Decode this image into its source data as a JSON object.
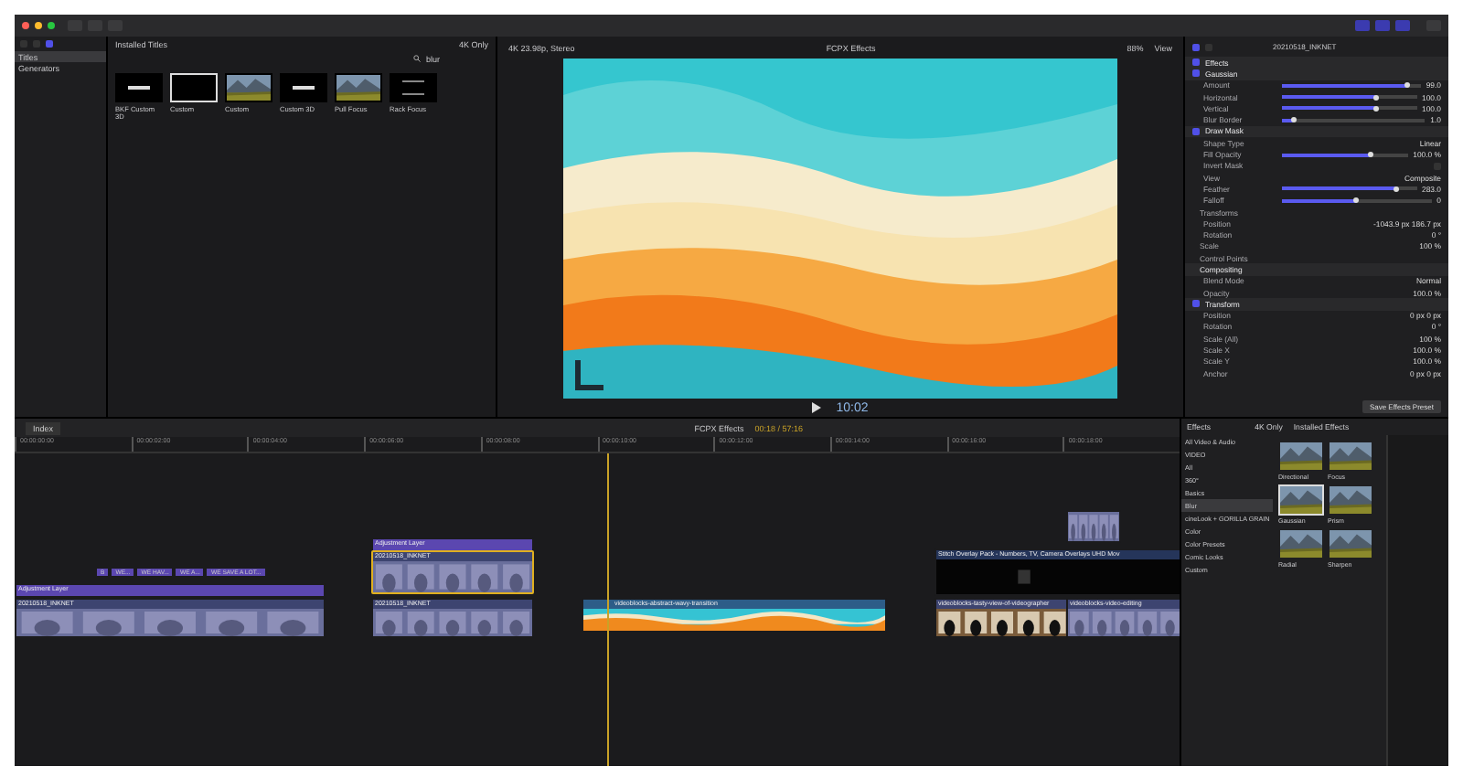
{
  "browser": {
    "sidebar": [
      {
        "label": "Titles",
        "selected": true
      },
      {
        "label": "Generators",
        "selected": false
      }
    ],
    "source": "Installed Titles",
    "filter": "4K Only",
    "search": "blur",
    "items": [
      {
        "label": "BKF Custom 3D",
        "kind": "text",
        "selected": false
      },
      {
        "label": "Custom",
        "kind": "dark",
        "selected": true
      },
      {
        "label": "Custom",
        "kind": "picture",
        "selected": false
      },
      {
        "label": "Custom 3D",
        "kind": "text",
        "selected": false
      },
      {
        "label": "Pull Focus",
        "kind": "picture",
        "selected": false
      },
      {
        "label": "Rack Focus",
        "kind": "lines",
        "selected": false
      }
    ]
  },
  "viewer": {
    "format": "4K 23.98p, Stereo",
    "title": "FCPX Effects",
    "zoom": "88%",
    "view": "View",
    "timecode": "10:02"
  },
  "inspector": {
    "clip": "20210518_INKNET",
    "rows": [
      {
        "kind": "section",
        "label": "Effects",
        "checked": true
      },
      {
        "kind": "section",
        "label": "Gaussian",
        "checked": true
      },
      {
        "kind": "param",
        "label": "Amount",
        "value": "99.0",
        "level": 0.9
      },
      {
        "kind": "param",
        "label": "Horizontal",
        "value": "100.0",
        "level": 0.7
      },
      {
        "kind": "param",
        "label": "Vertical",
        "value": "100.0",
        "level": 0.7
      },
      {
        "kind": "param",
        "label": "Blur Border",
        "value": "1.0",
        "level": 0.08
      },
      {
        "kind": "section",
        "label": "Draw Mask",
        "checked": true
      },
      {
        "kind": "param",
        "label": "Shape Type",
        "value": "Linear"
      },
      {
        "kind": "param",
        "label": "Fill Opacity",
        "value": "100.0 %",
        "level": 0.7
      },
      {
        "kind": "param",
        "label": "Invert Mask",
        "checked": false
      },
      {
        "kind": "param",
        "label": "View",
        "value": "Composite"
      },
      {
        "kind": "param",
        "label": "Feather",
        "value": "283.0",
        "level": 0.85
      },
      {
        "kind": "param",
        "label": "Falloff",
        "value": "0",
        "level": 0.5
      },
      {
        "kind": "group",
        "label": "Transforms"
      },
      {
        "kind": "param",
        "label": "Position",
        "value": "-1043.9 px   186.7 px"
      },
      {
        "kind": "param",
        "label": "Rotation",
        "value": "0 °"
      },
      {
        "kind": "group",
        "label": "Scale",
        "value": "100 %"
      },
      {
        "kind": "group",
        "label": "Control Points"
      },
      {
        "kind": "heading",
        "label": "Compositing"
      },
      {
        "kind": "param",
        "label": "Blend Mode",
        "value": "Normal"
      },
      {
        "kind": "param",
        "label": "Opacity",
        "value": "100.0 %"
      },
      {
        "kind": "section",
        "label": "Transform",
        "checked": true
      },
      {
        "kind": "param",
        "label": "Position",
        "value": "0 px   0 px"
      },
      {
        "kind": "param",
        "label": "Rotation",
        "value": "0 °"
      },
      {
        "kind": "param",
        "label": "Scale (All)",
        "value": "100 %"
      },
      {
        "kind": "param",
        "label": "Scale X",
        "value": "100.0 %"
      },
      {
        "kind": "param",
        "label": "Scale Y",
        "value": "100.0 %"
      },
      {
        "kind": "param",
        "label": "Anchor",
        "value": "0 px   0 px"
      }
    ],
    "save": "Save Effects Preset"
  },
  "timeline": {
    "index": "Index",
    "project": "FCPX Effects",
    "duration": "00:18 / 57:16",
    "ruler": [
      "00:00:00:00",
      "00:00:02:00",
      "00:00:04:00",
      "00:00:06:00",
      "00:00:08:00",
      "00:00:10:00",
      "00:00:12:00",
      "00:00:14:00",
      "00:00:16:00",
      "00:00:18:00"
    ],
    "clips": [
      {
        "kind": "video",
        "label": "20210518_INKNET",
        "selected": false
      },
      {
        "kind": "video",
        "label": "20210518_INKNET",
        "selected": false
      },
      {
        "kind": "waves",
        "label": "videoblocks-abstract-wavy-transition",
        "selected": false
      },
      {
        "kind": "people",
        "label": "videoblocks-tasty-view-of-videographer",
        "selected": false
      },
      {
        "kind": "video",
        "label": "videoblocks-video-editing",
        "selected": false
      },
      {
        "kind": "adjust",
        "label": "Adjustment Layer",
        "selected": false
      },
      {
        "kind": "adjust",
        "label": "Adjustment Layer",
        "selected": false
      },
      {
        "kind": "video",
        "label": "20210518_INKNET",
        "selected": true
      },
      {
        "kind": "dark",
        "label": "Stitch Overlay Pack - Numbers, TV, Camera Overlays UHD Mov",
        "selected": false
      },
      {
        "kind": "video",
        "selected": false
      }
    ],
    "titles": [
      "B",
      "WE...",
      "WE HAV...",
      "WE A...",
      "WE SAVE A LOT..."
    ]
  },
  "effects": {
    "title": "Effects",
    "filter": "4K Only",
    "source": "Installed Effects",
    "categories": [
      {
        "label": "All Video & Audio",
        "selected": false
      },
      {
        "label": "VIDEO",
        "selected": false
      },
      {
        "label": "All",
        "selected": false
      },
      {
        "label": "360°",
        "selected": false
      },
      {
        "label": "Basics",
        "selected": false
      },
      {
        "label": "Blur",
        "selected": true
      },
      {
        "label": "cineLook + GORILLA GRAIN",
        "selected": false
      },
      {
        "label": "Color",
        "selected": false
      },
      {
        "label": "Color Presets",
        "selected": false
      },
      {
        "label": "Comic Looks",
        "selected": false
      },
      {
        "label": "Custom",
        "selected": false
      }
    ],
    "items": [
      {
        "label": "Directional",
        "selected": false
      },
      {
        "label": "Focus",
        "selected": false
      },
      {
        "label": "Gaussian",
        "selected": true
      },
      {
        "label": "Prism",
        "selected": false
      },
      {
        "label": "Radial",
        "selected": false
      },
      {
        "label": "Sharpen",
        "selected": false
      }
    ]
  }
}
